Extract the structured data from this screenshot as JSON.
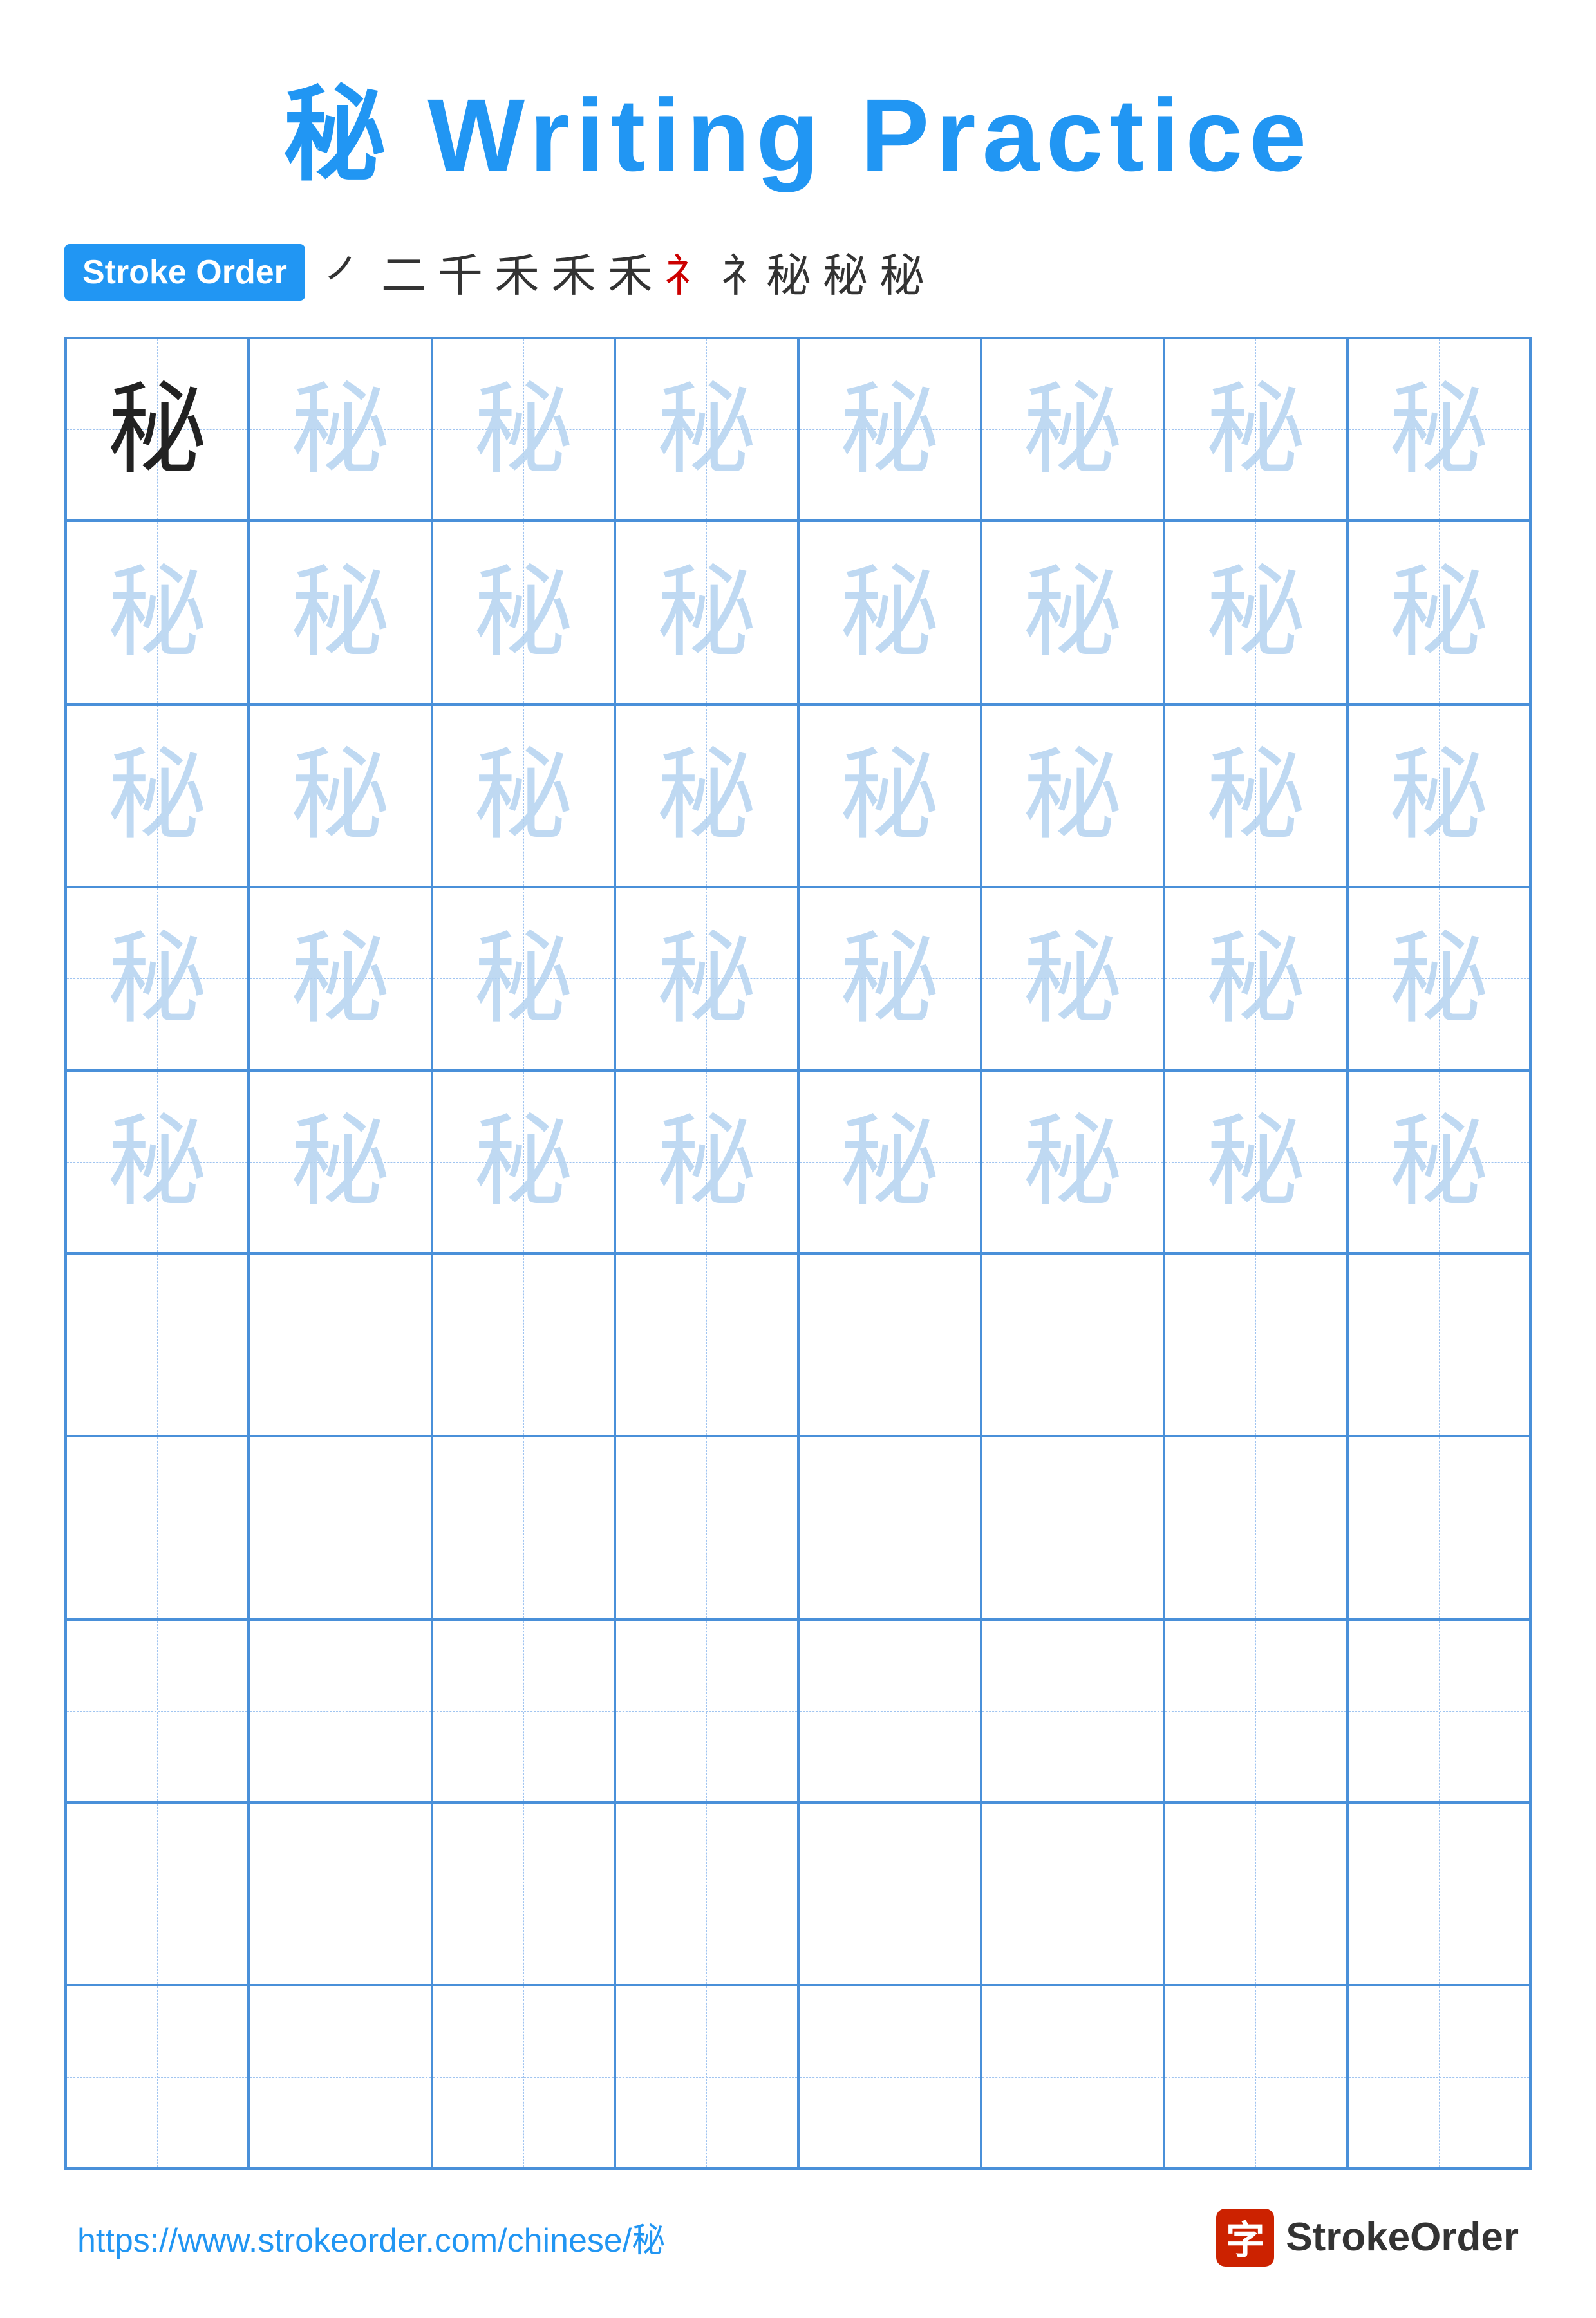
{
  "title": {
    "char": "秘",
    "label": "Writing Practice",
    "full": "秘 Writing Practice"
  },
  "stroke_order": {
    "badge_label": "Stroke Order",
    "strokes": [
      "㇒",
      "二",
      "千",
      "禾",
      "禾",
      "禾",
      "礻",
      "礻秘",
      "秘",
      "秘"
    ],
    "stroke_sequence_display": [
      "㇒",
      "二",
      "千",
      "禾",
      "禾",
      "禾",
      "礻",
      "礻",
      "秘",
      "秘"
    ]
  },
  "grid": {
    "rows": 10,
    "cols": 8,
    "char": "秘",
    "practice_rows": 5,
    "empty_rows": 5
  },
  "footer": {
    "url": "https://www.strokeorder.com/chinese/秘",
    "logo_text": "StrokeOrder",
    "logo_icon": "字"
  }
}
